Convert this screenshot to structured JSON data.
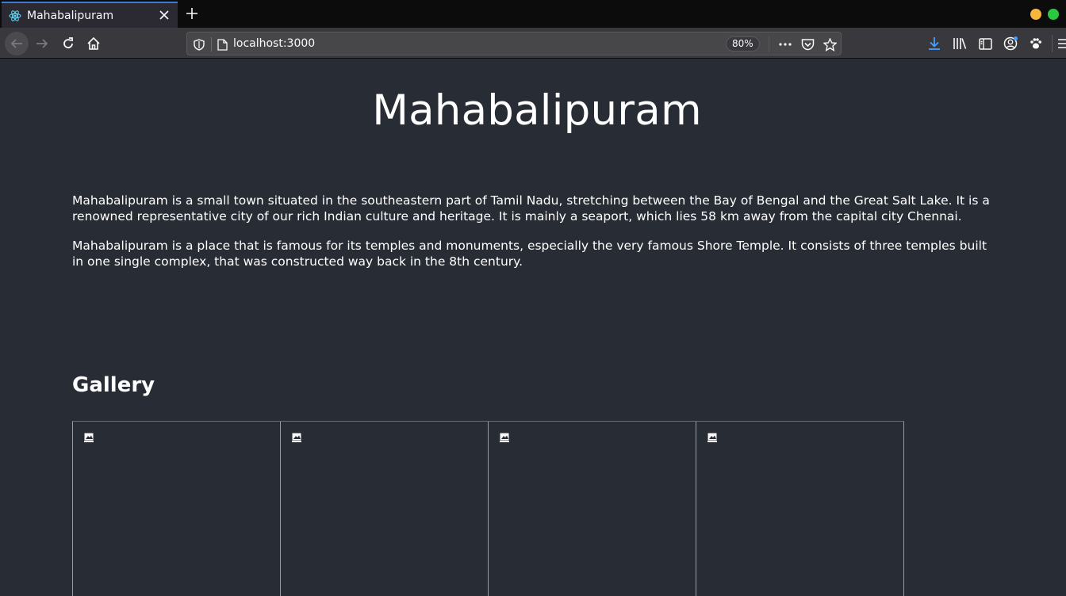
{
  "browser": {
    "tab_title": "Mahabalipuram",
    "url": "localhost:3000",
    "zoom": "80%",
    "colors": {
      "tab_accent": "#3a7bd5",
      "minimize": "#f6b73c",
      "maximize": "#2ac940"
    }
  },
  "page": {
    "title": "Mahabalipuram",
    "paragraphs": [
      "Mahabalipuram is a small town situated in the southeastern part of Tamil Nadu, stretching between the Bay of Bengal and the Great Salt Lake. It is a renowned representative city of our rich Indian culture and heritage. It is mainly a seaport, which lies 58 km away from the capital city Chennai.",
      "Mahabalipuram is a place that is famous for its temples and monuments, especially the very famous Shore Temple. It consists of three temples built in one single complex, that was constructed way back in the 8th century."
    ],
    "gallery_heading": "Gallery",
    "gallery_images": [
      "broken-image-icon",
      "broken-image-icon",
      "broken-image-icon",
      "broken-image-icon"
    ],
    "background": "#282c34"
  }
}
